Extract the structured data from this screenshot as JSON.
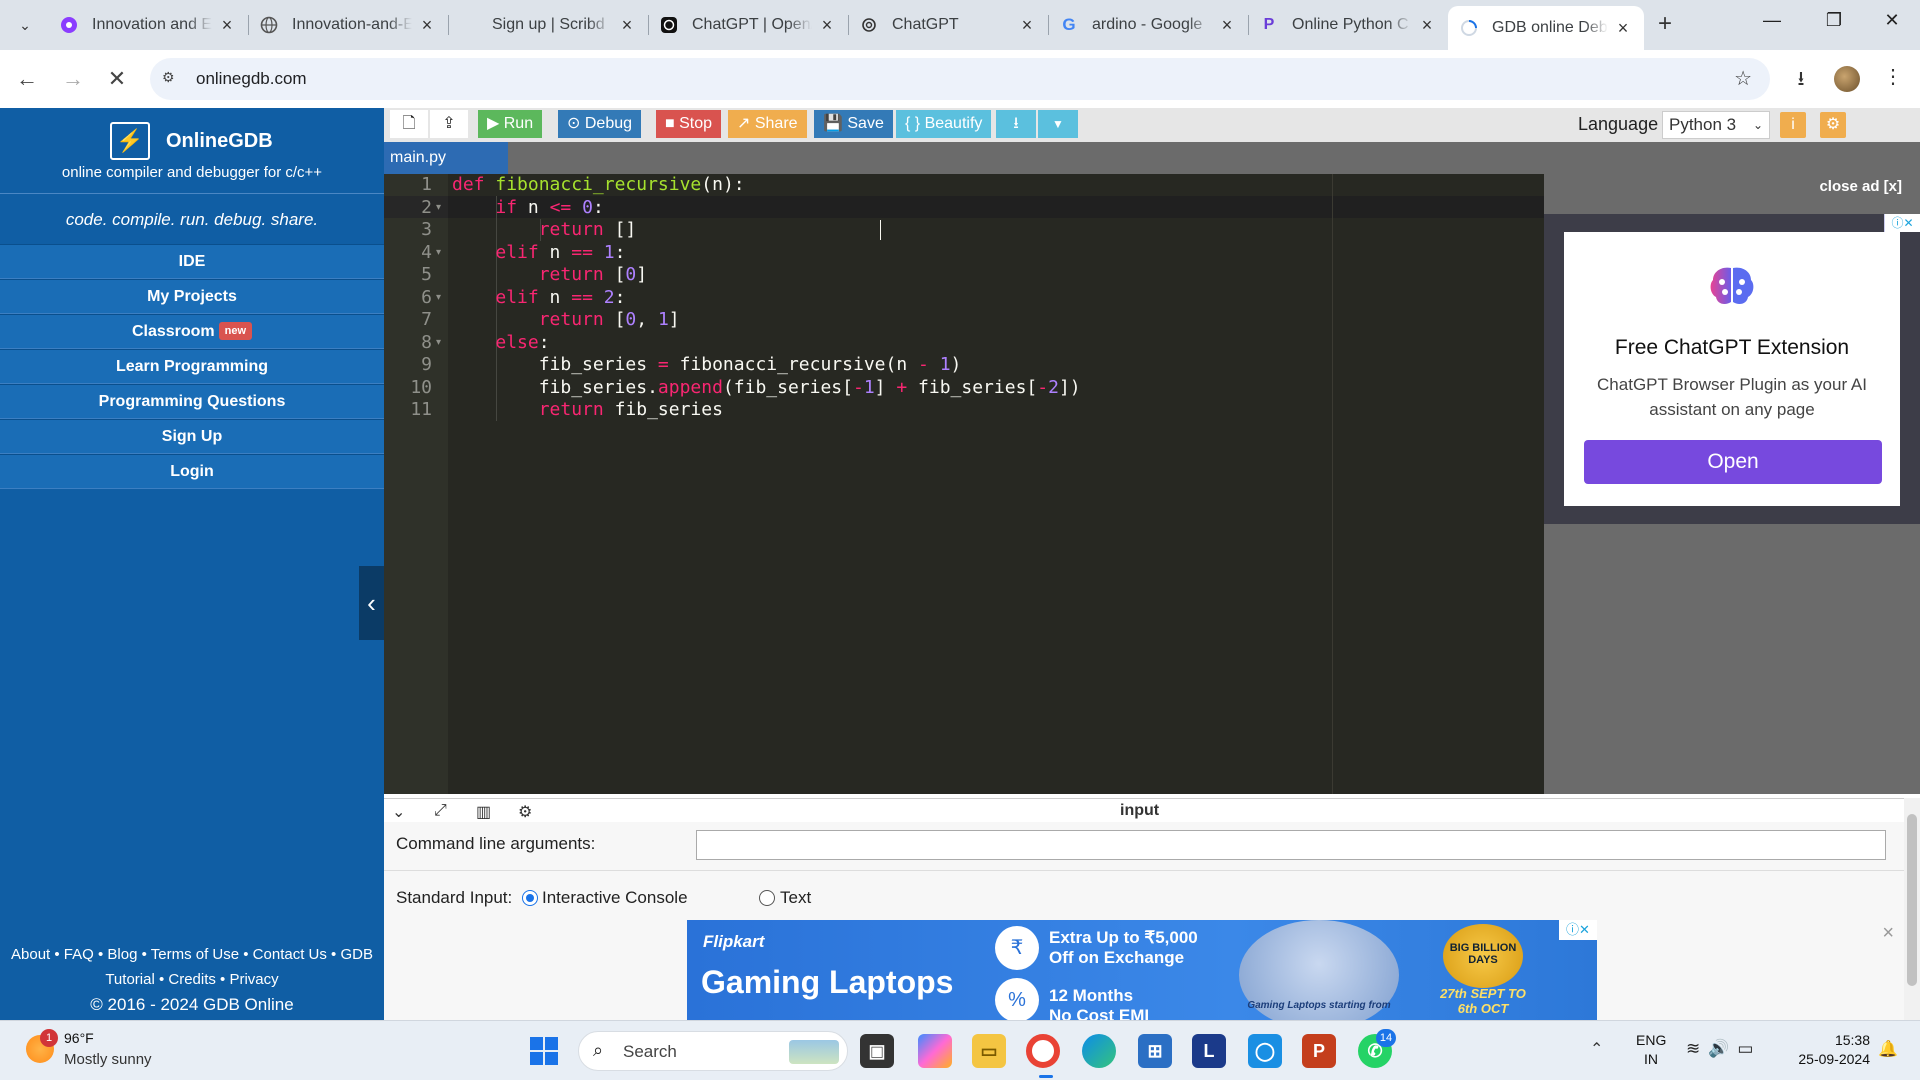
{
  "browser": {
    "tabs": [
      {
        "title": "Innovation and E",
        "icon": "canva-icon"
      },
      {
        "title": "Innovation-and-E",
        "icon": "globe-icon"
      },
      {
        "title": "Sign up | Scribd",
        "icon": "scribd-icon"
      },
      {
        "title": "ChatGPT | Open/",
        "icon": "chatgpt-icon"
      },
      {
        "title": "ChatGPT",
        "icon": "chatgpt-icon"
      },
      {
        "title": "ardino - Google",
        "icon": "google-icon"
      },
      {
        "title": "Online Python C",
        "icon": "python-icon"
      },
      {
        "title": "GDB online Debu",
        "icon": "loading-icon",
        "active": true
      }
    ],
    "url": "onlinegdb.com"
  },
  "sidebar": {
    "logo": "OnlineGDB",
    "subtitle": "online compiler and debugger for c/c++",
    "tagline": "code. compile. run. debug. share.",
    "nav": [
      {
        "label": "IDE"
      },
      {
        "label": "My Projects"
      },
      {
        "label": "Classroom",
        "badge": "new"
      },
      {
        "label": "Learn Programming"
      },
      {
        "label": "Programming Questions"
      },
      {
        "label": "Sign Up"
      },
      {
        "label": "Login"
      }
    ],
    "footer_links_1": "About • FAQ • Blog • Terms of Use • Contact Us • GDB",
    "footer_links_2": "Tutorial • Credits • Privacy",
    "copyright": "© 2016 - 2024 GDB Online"
  },
  "toolbar": {
    "run": "Run",
    "debug": "Debug",
    "stop": "Stop",
    "share": "Share",
    "save": "Save",
    "beautify": "{ } Beautify",
    "language_label": "Language",
    "language_value": "Python 3",
    "colors": {
      "run": "#5cb85c",
      "debug": "#337ab7",
      "stop": "#d9534f",
      "share": "#f0ad4e",
      "save": "#337ab7",
      "beautify": "#5bc0de"
    }
  },
  "editor": {
    "file_tab": "main.py",
    "line_numbers": [
      "1",
      "2",
      "3",
      "4",
      "5",
      "6",
      "7",
      "8",
      "9",
      "10",
      "11"
    ],
    "colors": {
      "background": "#272822",
      "keyword": "#f92672",
      "function": "#a6e22e",
      "number": "#ae81ff"
    }
  },
  "ad_right": {
    "close": "close ad [x]",
    "title": "Free ChatGPT Extension",
    "desc": "ChatGPT Browser Plugin as your AI assistant on any page",
    "button": "Open"
  },
  "io": {
    "title": "input",
    "cla_label": "Command line arguments:",
    "cla_value": "",
    "stdin_label": "Standard Input:",
    "option_interactive": "Interactive Console",
    "option_text": "Text",
    "selected": "Interactive Console"
  },
  "bottom_ad": {
    "brand": "Flipkart",
    "headline": "Gaming Laptops",
    "offer1_line1": "Extra Up to ₹5,000",
    "offer1_line2": "Off on Exchange",
    "offer2_line1": "12 Months",
    "offer2_line2": "No Cost EMI",
    "laptop_caption": "Gaming Laptops starting from",
    "sale": "BIG BILLION DAYS",
    "dates": "27th SEPT TO 6th OCT"
  },
  "taskbar": {
    "weather_badge": "1",
    "temperature": "96°F",
    "condition": "Mostly sunny",
    "search": "Search",
    "language_line1": "ENG",
    "language_line2": "IN",
    "time": "15:38",
    "date": "25-09-2024",
    "whatsapp_badge": "14"
  }
}
